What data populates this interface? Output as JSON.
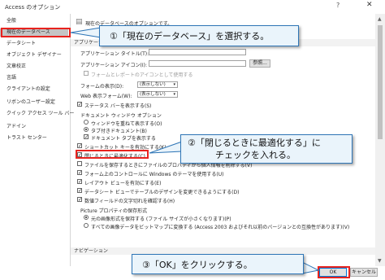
{
  "window": {
    "title": "Access のオプション",
    "help_glyph": "?",
    "close_glyph": "✕"
  },
  "sidebar": {
    "items": [
      {
        "label": "全般"
      },
      {
        "label": "現在のデータベース",
        "active": true
      },
      {
        "label": "データシート"
      },
      {
        "label": "オブジェクト デザイナー"
      },
      {
        "label": "文章校正"
      },
      {
        "label": "言語"
      },
      {
        "label": "クライアントの設定"
      },
      {
        "label": "リボンのユーザー設定"
      },
      {
        "label": "クイック アクセス ツール バー"
      },
      {
        "label": "アドイン"
      },
      {
        "label": "トラスト センター"
      }
    ]
  },
  "main": {
    "intro": "現在のデータベースのオプションです。",
    "app_options_header": "アプリケーション オプション",
    "app_title_label": "アプリケーション タイトル(T):",
    "app_icon_label": "アプリケーション アイコン(I):",
    "browse_button": "参照...",
    "form_report_icon_label": "フォームとレポートのアイコンとして使用する",
    "display_form_label": "フォームの表示(D):",
    "display_form_value": "(表示しない)",
    "web_form_label": "Web 表示フォーム(W):",
    "web_form_value": "(表示しない)",
    "status_bar_label": "ステータス バーを表示する(S)",
    "doc_window_options_label": "ドキュメント ウィンドウ オプション",
    "overlap_windows_label": "ウィンドウを重ねて表示する(O)",
    "tabbed_docs_label": "タブ付きドキュメント(B)",
    "doc_tabs_label": "ドキュメント タブを表示する",
    "shortcut_keys_label": "ショートカット キーを有効にする(K)",
    "compact_on_close_label": "閉じるときに最適化する(C)",
    "remove_personal_label": "ファイルを保存するときにファイルのプロパティから個人情報を削除する(V)",
    "windows_theme_label": "フォーム上のコントロールに Windows のテーマを使用する(U)",
    "layout_view_label": "レイアウト ビューを有効にする(E)",
    "datasheet_design_label": "データシート ビューでテーブルのデザインを変更できるようにする(D)",
    "truncated_fields_label": "数値フィールドの文字切れを確認する(H)",
    "picture_property_label": "Picture プロパティの保存形式",
    "preserve_image_label": "元の画像形式を保持する (ファイル サイズが小さくなります)(P)",
    "convert_image_label": "すべての画像データをビットマップに変換する (Access 2003 およびそれ以前のバージョンとの互換性があります)(V)",
    "navigation_header": "ナビゲーション"
  },
  "footer": {
    "ok_label": "OK",
    "cancel_label": "キャンセル"
  },
  "annotations": {
    "step1": "①「現在のデータベース」を選択する。",
    "step2_line1": "②「閉じるときに最適化する」に",
    "step2_line2": "チェックを入れる。",
    "step3": "③「OK」をクリックする。",
    "highlight_color": "#e8231e",
    "callout_bg": "#eaf4fb",
    "callout_border": "#2e75b6"
  },
  "colors": {
    "sidebar_active": "#c5c5c5",
    "section_header_bg": "#f2f2f2"
  }
}
